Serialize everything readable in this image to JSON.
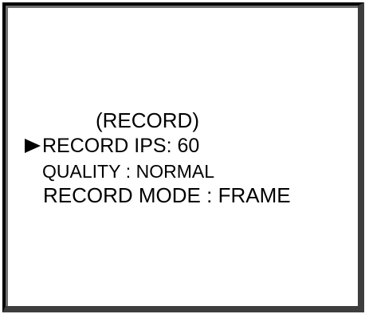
{
  "menu": {
    "title": "(RECORD)",
    "selected_index": 0,
    "cursor_icon": "right-pointer-icon",
    "items": [
      {
        "label": "RECORD IPS",
        "separator": ": ",
        "value": "60"
      },
      {
        "label": "QUALITY",
        "separator": " : ",
        "value": "NORMAL"
      },
      {
        "label": "RECORD MODE",
        "separator": " : ",
        "value": "FRAME"
      }
    ]
  }
}
